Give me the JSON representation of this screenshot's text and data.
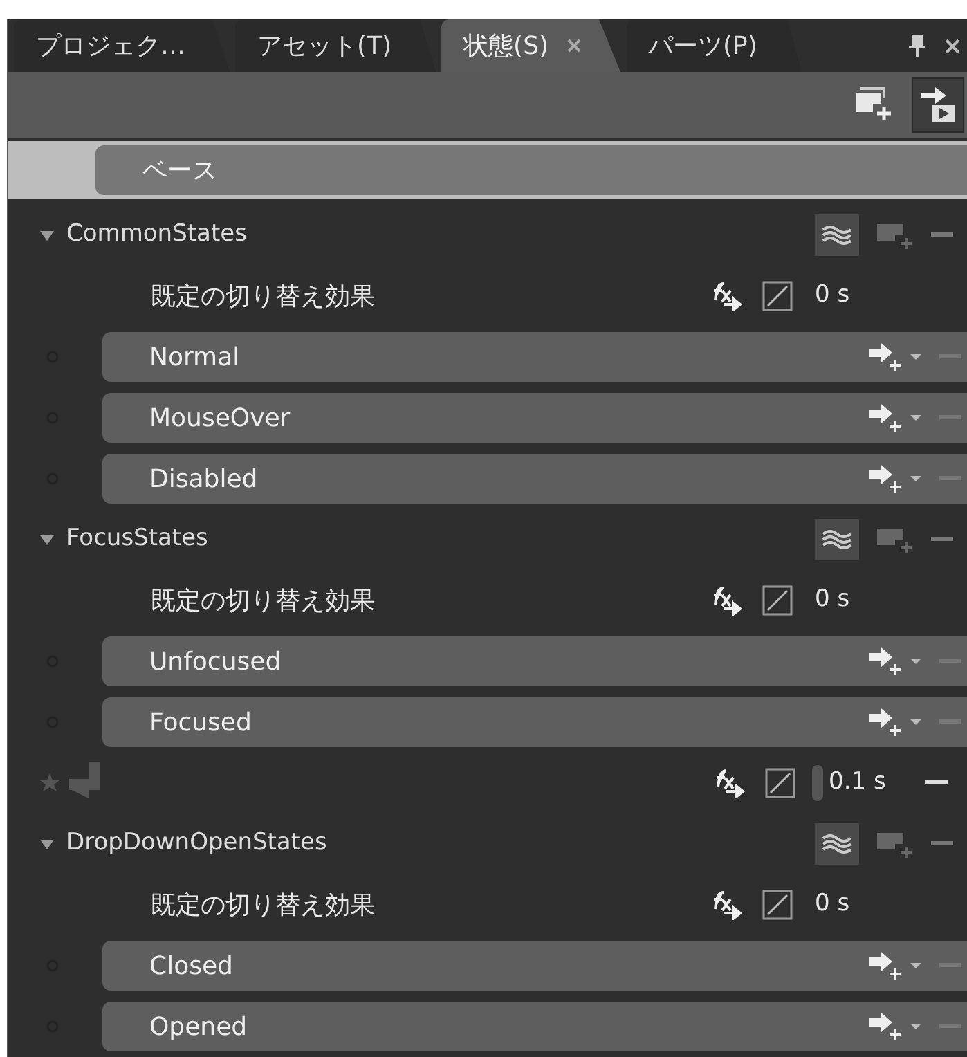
{
  "tabs": [
    {
      "label": "プロジェク…",
      "selected": false
    },
    {
      "label": "アセット(T)",
      "selected": false
    },
    {
      "label": "状態(S)",
      "selected": true
    },
    {
      "label": "パーツ(P)",
      "selected": false
    }
  ],
  "base": {
    "label": "ベース",
    "selected": true
  },
  "groups": [
    {
      "name": "CommonStates",
      "expanded": true,
      "default_transition": {
        "label": "既定の切り替え効果",
        "duration": "0 s"
      },
      "states": [
        {
          "name": "Normal"
        },
        {
          "name": "MouseOver"
        },
        {
          "name": "Disabled"
        }
      ]
    },
    {
      "name": "FocusStates",
      "expanded": true,
      "default_transition": {
        "label": "既定の切り替え効果",
        "duration": "0 s"
      },
      "states": [
        {
          "name": "Unfocused"
        },
        {
          "name": "Focused"
        }
      ],
      "transitions": [
        {
          "duration": "0.1 s"
        }
      ]
    },
    {
      "name": "DropDownOpenStates",
      "expanded": true,
      "default_transition": {
        "label": "既定の切り替え効果",
        "duration": "0 s"
      },
      "states": [
        {
          "name": "Closed"
        },
        {
          "name": "Opened"
        }
      ]
    }
  ]
}
